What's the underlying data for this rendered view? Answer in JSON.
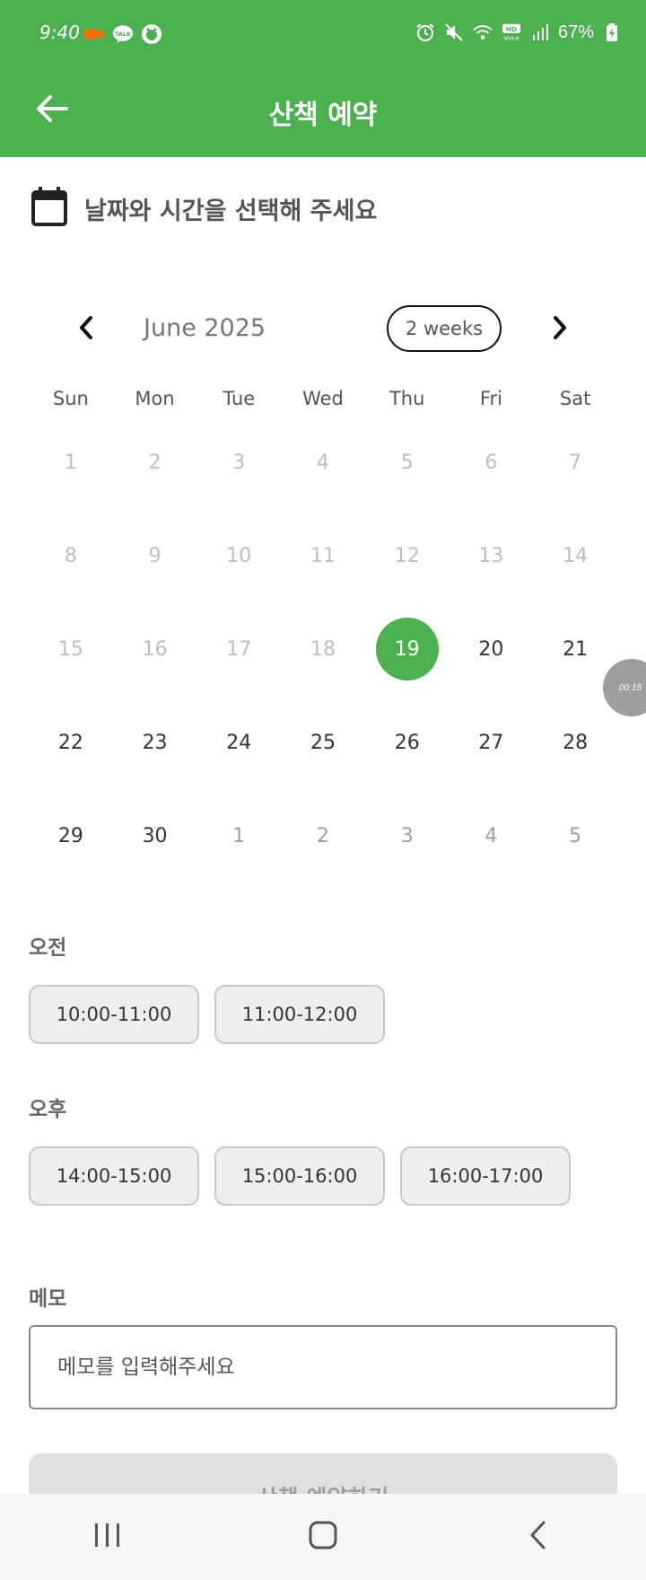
{
  "status_bar": {
    "time": "9:40",
    "battery": "67%",
    "left_icons": [
      "video-camera-icon",
      "kakaotalk-icon",
      "cat-app-icon"
    ],
    "right_icons": [
      "alarm-icon",
      "mute-icon",
      "wifi-icon",
      "hd-voice-icon",
      "signal-icon",
      "battery-icon"
    ]
  },
  "app_bar": {
    "title": "산책 예약",
    "back_icon": "arrow-left-icon",
    "background": "#4caf50"
  },
  "section": {
    "title": "날짜와 시간을 선택해 주세요",
    "icon": "calendar-icon"
  },
  "calendar": {
    "month_label": "June 2025",
    "format_button": "2 weeks",
    "weekdays": [
      "Sun",
      "Mon",
      "Tue",
      "Wed",
      "Thu",
      "Fri",
      "Sat"
    ],
    "selected_day": "19",
    "selected_color": "#4caf50",
    "days": [
      {
        "d": "1",
        "s": "disabled"
      },
      {
        "d": "2",
        "s": "disabled"
      },
      {
        "d": "3",
        "s": "disabled"
      },
      {
        "d": "4",
        "s": "disabled"
      },
      {
        "d": "5",
        "s": "disabled"
      },
      {
        "d": "6",
        "s": "disabled"
      },
      {
        "d": "7",
        "s": "disabled"
      },
      {
        "d": "8",
        "s": "disabled"
      },
      {
        "d": "9",
        "s": "disabled"
      },
      {
        "d": "10",
        "s": "disabled"
      },
      {
        "d": "11",
        "s": "disabled"
      },
      {
        "d": "12",
        "s": "disabled"
      },
      {
        "d": "13",
        "s": "disabled"
      },
      {
        "d": "14",
        "s": "disabled"
      },
      {
        "d": "15",
        "s": "disabled"
      },
      {
        "d": "16",
        "s": "disabled"
      },
      {
        "d": "17",
        "s": "disabled"
      },
      {
        "d": "18",
        "s": "disabled"
      },
      {
        "d": "19",
        "s": "selected"
      },
      {
        "d": "20",
        "s": "enabled"
      },
      {
        "d": "21",
        "s": "enabled"
      },
      {
        "d": "22",
        "s": "enabled"
      },
      {
        "d": "23",
        "s": "enabled"
      },
      {
        "d": "24",
        "s": "enabled"
      },
      {
        "d": "25",
        "s": "enabled"
      },
      {
        "d": "26",
        "s": "enabled"
      },
      {
        "d": "27",
        "s": "enabled"
      },
      {
        "d": "28",
        "s": "enabled"
      },
      {
        "d": "29",
        "s": "enabled"
      },
      {
        "d": "30",
        "s": "enabled"
      },
      {
        "d": "1",
        "s": "outside"
      },
      {
        "d": "2",
        "s": "outside"
      },
      {
        "d": "3",
        "s": "outside"
      },
      {
        "d": "4",
        "s": "outside"
      },
      {
        "d": "5",
        "s": "outside"
      }
    ]
  },
  "floating_timer": {
    "label": "00:15"
  },
  "morning": {
    "label": "오전",
    "slots": [
      "10:00-11:00",
      "11:00-12:00"
    ]
  },
  "afternoon": {
    "label": "오후",
    "slots": [
      "14:00-15:00",
      "15:00-16:00",
      "16:00-17:00"
    ]
  },
  "memo": {
    "label": "메모",
    "placeholder": "메모를 입력해주세요",
    "value": ""
  },
  "submit": {
    "label": "산책 예약하기"
  },
  "nav_bar": {
    "buttons": [
      "recent-apps-icon",
      "home-icon",
      "back-icon"
    ]
  }
}
